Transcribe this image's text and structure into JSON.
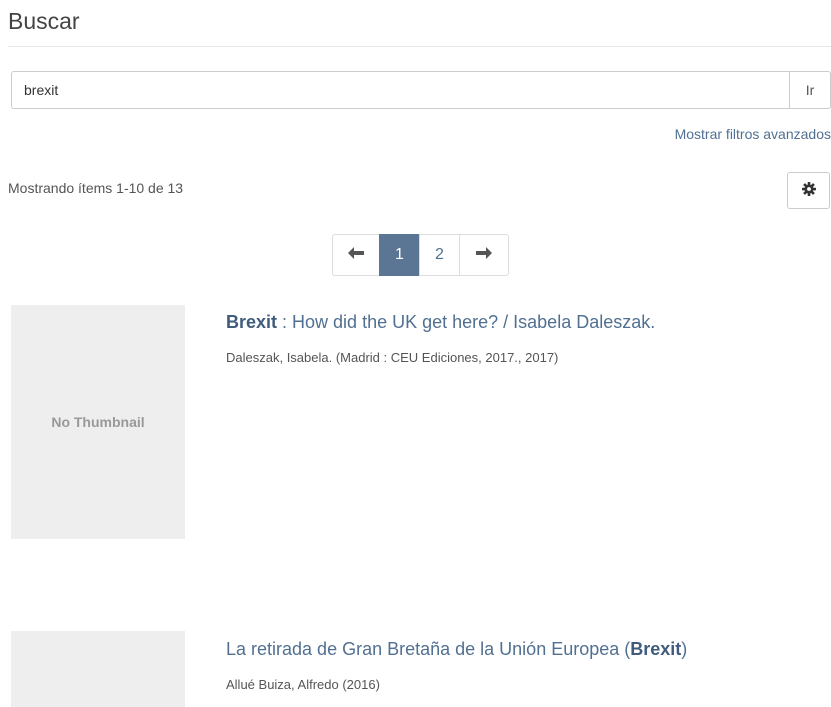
{
  "header": {
    "title": "Buscar"
  },
  "search": {
    "value": "brexit",
    "go_label": "Ir"
  },
  "filters": {
    "toggle_label": "Mostrar filtros avanzados"
  },
  "results": {
    "summary": "Mostrando ítems 1-10 de 13"
  },
  "pagination": {
    "prev_icon": "arrow-left-icon",
    "pages": [
      "1",
      "2"
    ],
    "current": "1",
    "next_icon": "arrow-right-icon"
  },
  "items": [
    {
      "thumbnail_label": "No Thumbnail",
      "title_before": "",
      "title_bold": "Brexit",
      "title_after": " : How did the UK get here? / Isabela Daleszak.",
      "meta": "Daleszak, Isabela. (Madrid : CEU Ediciones, 2017., 2017)"
    },
    {
      "thumbnail_label": "",
      "title_before": "La retirada de Gran Bretaña de la Unión Europea (",
      "title_bold": "Brexit",
      "title_after": ")",
      "meta": "Allué Buiza, Alfredo (2016)"
    }
  ],
  "colors": {
    "link": "#517091",
    "active_page": "#5b7595",
    "thumb_bg": "#eeeeee"
  }
}
